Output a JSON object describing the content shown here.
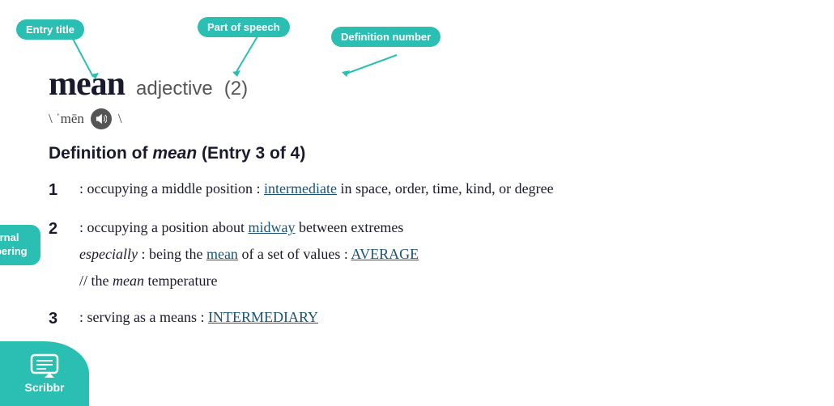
{
  "annotations": {
    "entry_title": "Entry title",
    "part_of_speech": "Part of speech",
    "definition_number": "Definition number",
    "internal_numbering": "Internal\nnumbering"
  },
  "entry": {
    "word": "mean",
    "pos": "adjective",
    "num": "(2)",
    "pronunciation": "\\ ˈmēn \\",
    "definition_header": "Definition of mean (Entry 3 of 4)"
  },
  "definitions": [
    {
      "number": "1",
      "text": ": occupying a middle position : ",
      "link_text": "intermediate",
      "rest": " in space, order, time, kind, or degree",
      "sub": null
    },
    {
      "number": "2",
      "text": ": occupying a position about ",
      "link_text": "midway",
      "rest": " between extremes",
      "sub": {
        "italic_prefix": "especially",
        "middle": " : being the ",
        "link_text2": "mean",
        "rest2": " of a set of values : ",
        "link_text3": "AVERAGE",
        "line2": "// the ",
        "italic2": "mean",
        "rest3": " temperature"
      }
    },
    {
      "number": "3",
      "text": ": serving as a means : ",
      "link_text": "INTERMEDIARY",
      "rest": "",
      "sub": null
    }
  ],
  "scribbr": {
    "label": "Scribbr"
  }
}
